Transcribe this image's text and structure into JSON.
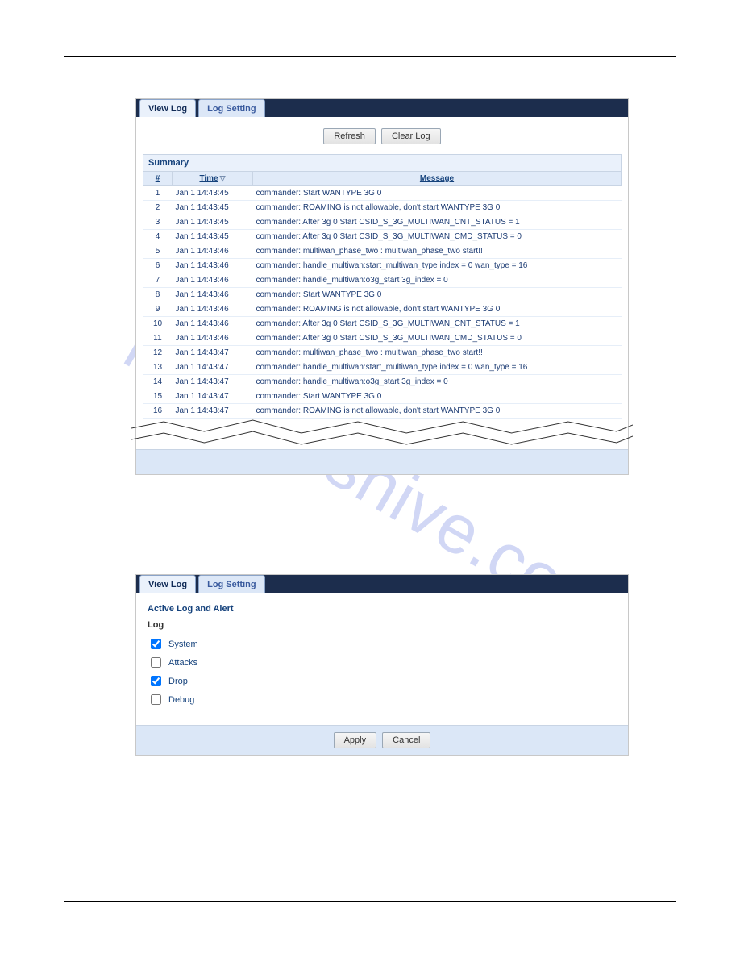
{
  "watermark": "manualshive.com",
  "panel1": {
    "tabs": {
      "view": "View Log",
      "setting": "Log Setting"
    },
    "toolbar": {
      "refresh": "Refresh",
      "clear": "Clear Log"
    },
    "summary_title": "Summary",
    "columns": {
      "idx": "#",
      "time": "Time",
      "message": "Message"
    },
    "rows": [
      {
        "n": "1",
        "t": "Jan 1 14:43:45",
        "m": "commander: Start WANTYPE 3G 0"
      },
      {
        "n": "2",
        "t": "Jan 1 14:43:45",
        "m": "commander: ROAMING is not allowable, don't start WANTYPE 3G 0"
      },
      {
        "n": "3",
        "t": "Jan 1 14:43:45",
        "m": "commander: After 3g 0 Start CSID_S_3G_MULTIWAN_CNT_STATUS = 1"
      },
      {
        "n": "4",
        "t": "Jan 1 14:43:45",
        "m": "commander: After 3g 0 Start CSID_S_3G_MULTIWAN_CMD_STATUS = 0"
      },
      {
        "n": "5",
        "t": "Jan 1 14:43:46",
        "m": "commander: multiwan_phase_two : multiwan_phase_two start!!"
      },
      {
        "n": "6",
        "t": "Jan 1 14:43:46",
        "m": "commander: handle_multiwan:start_multiwan_type index = 0 wan_type = 16"
      },
      {
        "n": "7",
        "t": "Jan 1 14:43:46",
        "m": "commander: handle_multiwan:o3g_start 3g_index = 0"
      },
      {
        "n": "8",
        "t": "Jan 1 14:43:46",
        "m": "commander: Start WANTYPE 3G 0"
      },
      {
        "n": "9",
        "t": "Jan 1 14:43:46",
        "m": "commander: ROAMING is not allowable, don't start WANTYPE 3G 0"
      },
      {
        "n": "10",
        "t": "Jan 1 14:43:46",
        "m": "commander: After 3g 0 Start CSID_S_3G_MULTIWAN_CNT_STATUS = 1"
      },
      {
        "n": "11",
        "t": "Jan 1 14:43:46",
        "m": "commander: After 3g 0 Start CSID_S_3G_MULTIWAN_CMD_STATUS = 0"
      },
      {
        "n": "12",
        "t": "Jan 1 14:43:47",
        "m": "commander: multiwan_phase_two : multiwan_phase_two start!!"
      },
      {
        "n": "13",
        "t": "Jan 1 14:43:47",
        "m": "commander: handle_multiwan:start_multiwan_type index = 0 wan_type = 16"
      },
      {
        "n": "14",
        "t": "Jan 1 14:43:47",
        "m": "commander: handle_multiwan:o3g_start 3g_index = 0"
      },
      {
        "n": "15",
        "t": "Jan 1 14:43:47",
        "m": "commander: Start WANTYPE 3G 0"
      },
      {
        "n": "16",
        "t": "Jan 1 14:43:47",
        "m": "commander: ROAMING is not allowable, don't start WANTYPE 3G 0"
      }
    ]
  },
  "panel2": {
    "tabs": {
      "view": "View Log",
      "setting": "Log Setting"
    },
    "section_title": "Active Log and Alert",
    "sub_title": "Log",
    "options": {
      "system": {
        "label": "System",
        "checked": true
      },
      "attacks": {
        "label": "Attacks",
        "checked": false
      },
      "drop": {
        "label": "Drop",
        "checked": true
      },
      "debug": {
        "label": "Debug",
        "checked": false
      }
    },
    "buttons": {
      "apply": "Apply",
      "cancel": "Cancel"
    }
  }
}
